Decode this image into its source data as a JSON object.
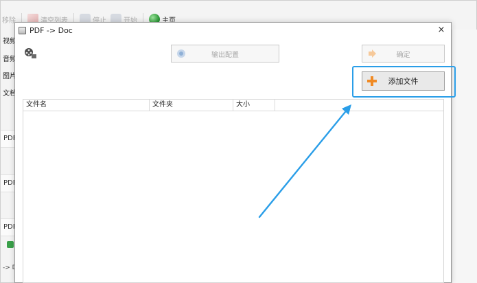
{
  "background_app": {
    "toolbar": {
      "remove_partial": "移除",
      "clear_list": "清空列表",
      "stop": "停止",
      "start": "开始",
      "home": "主页"
    },
    "sidebar": {
      "video": "视频",
      "audio": "音频",
      "image": "图片",
      "document": "文档",
      "rows": [
        "PDF",
        "PDF",
        "PDF"
      ],
      "bottom_arrow": "-> D"
    }
  },
  "dialog": {
    "title": "PDF -> Doc",
    "close_glyph": "×",
    "output_config_label": "输出配置",
    "ok_label": "确定",
    "add_file_label": "添加文件",
    "table": {
      "columns": [
        "文件名",
        "文件夹",
        "大小",
        ""
      ]
    }
  },
  "colors": {
    "highlight": "#2a9ee8",
    "arrow": "#2a9ee8"
  }
}
